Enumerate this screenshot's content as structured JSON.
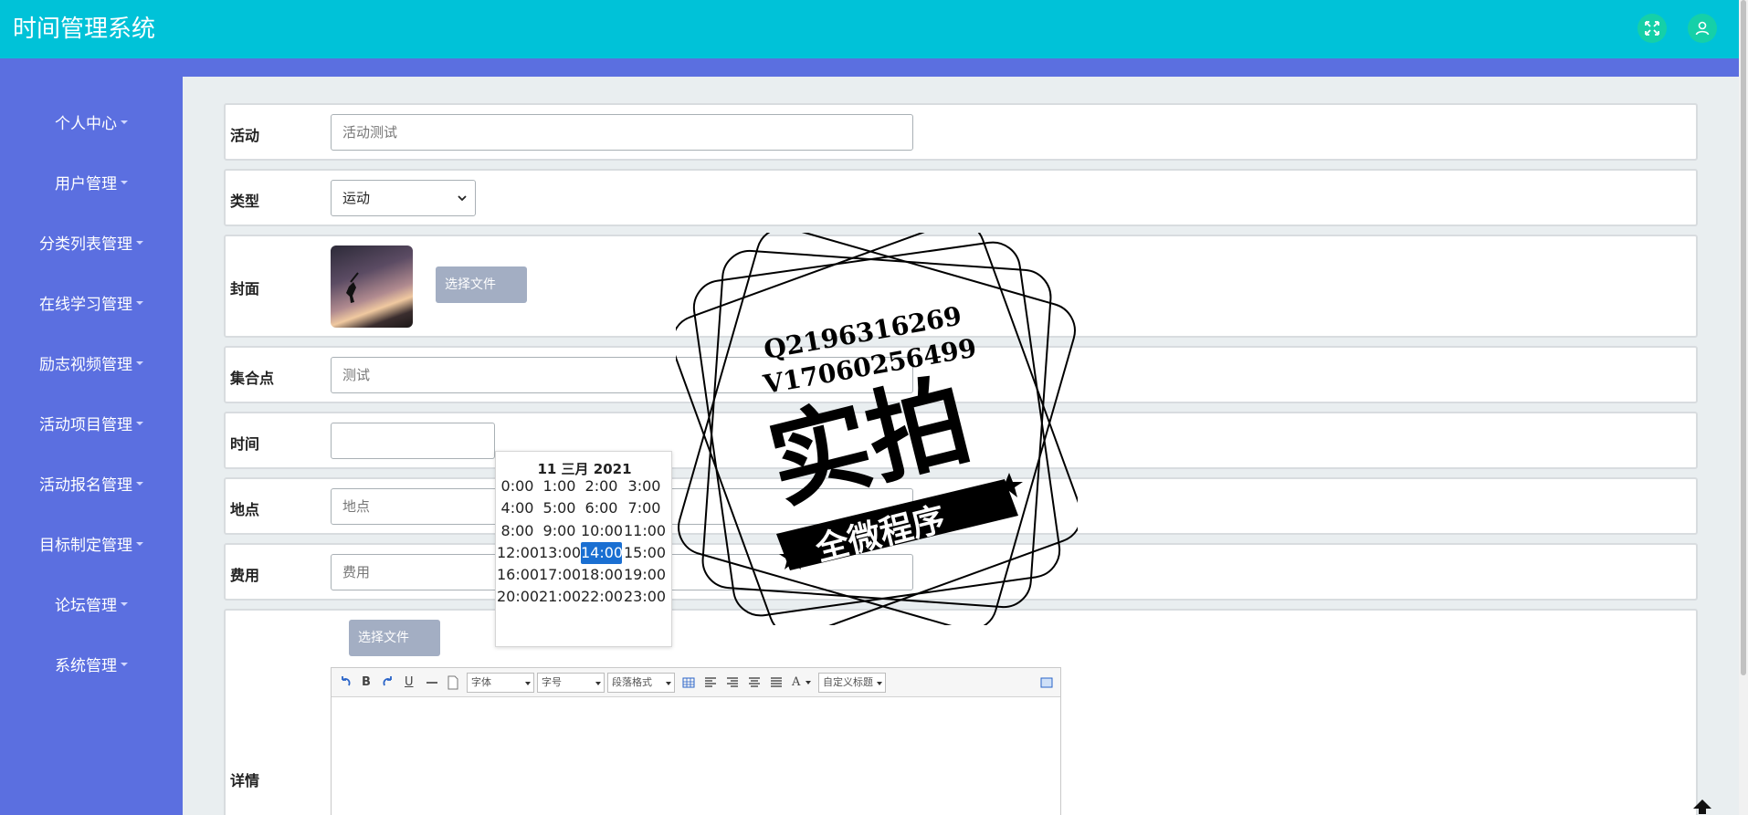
{
  "header": {
    "title": "时间管理系统",
    "fullscreen_icon": "fullscreen-icon",
    "user_icon": "user-icon"
  },
  "sidebar": {
    "items": [
      {
        "label": "个人中心"
      },
      {
        "label": "用户管理"
      },
      {
        "label": "分类列表管理"
      },
      {
        "label": "在线学习管理"
      },
      {
        "label": "励志视频管理"
      },
      {
        "label": "活动项目管理"
      },
      {
        "label": "活动报名管理"
      },
      {
        "label": "目标制定管理"
      },
      {
        "label": "论坛管理"
      },
      {
        "label": "系统管理"
      }
    ]
  },
  "form": {
    "activity": {
      "label": "活动",
      "value": "活动测试"
    },
    "type": {
      "label": "类型",
      "value": "运动"
    },
    "cover": {
      "label": "封面",
      "button": "选择文件"
    },
    "meeting_point": {
      "label": "集合点",
      "value": "测试"
    },
    "time": {
      "label": "时间",
      "value": ""
    },
    "location": {
      "label": "地点",
      "placeholder": "地点"
    },
    "fee": {
      "label": "费用",
      "placeholder": "费用"
    },
    "details": {
      "label": "详情",
      "button": "选择文件"
    }
  },
  "timepicker": {
    "date": "11 三月 2021",
    "slots": [
      "0:00",
      "1:00",
      "2:00",
      "3:00",
      "4:00",
      "5:00",
      "6:00",
      "7:00",
      "8:00",
      "9:00",
      "10:00",
      "11:00",
      "12:00",
      "13:00",
      "14:00",
      "15:00",
      "16:00",
      "17:00",
      "18:00",
      "19:00",
      "20:00",
      "21:00",
      "22:00",
      "23:00"
    ],
    "selected": "14:00"
  },
  "editor": {
    "font_select": "字体",
    "size_select": "字号",
    "format_select": "段落格式",
    "custom_title_select": "自定义标题",
    "bold": "B",
    "underline": "U",
    "font_color": "A"
  },
  "watermark": {
    "line1": "Q2196316269",
    "line2": "V17060256499",
    "main": "实拍",
    "banner": "全微程序"
  },
  "colors": {
    "header": "#00c2d8",
    "sidebar": "#5b6fe0",
    "selected_slot": "#1a6fd2",
    "file_button": "#a3aec3"
  }
}
